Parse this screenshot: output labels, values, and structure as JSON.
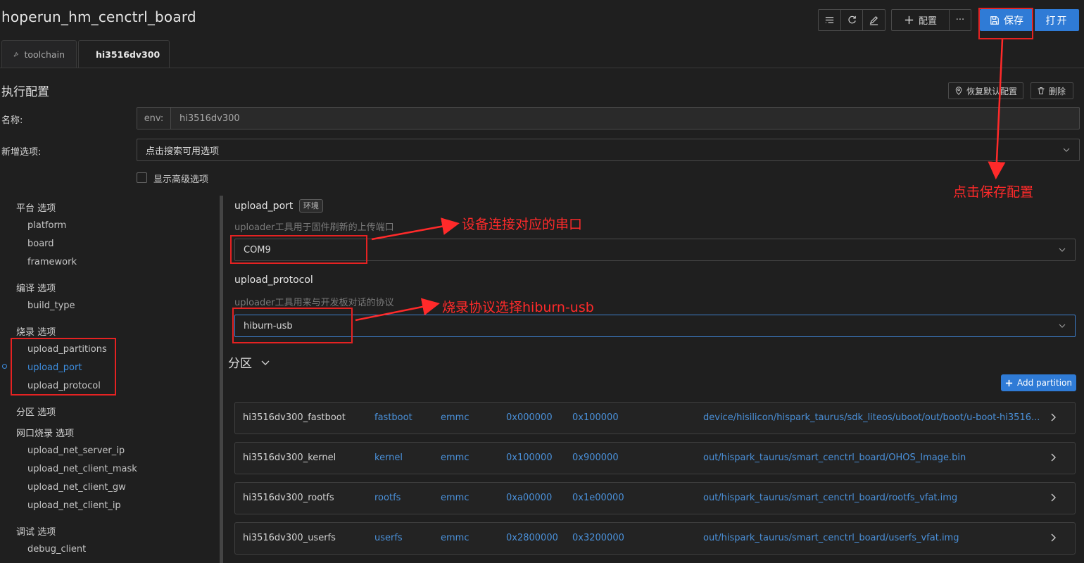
{
  "window": {
    "title": "hoperun_hm_cenctrl_board"
  },
  "toolbar": {
    "list_icon": "list-icon",
    "refresh_icon": "refresh-icon",
    "edit_icon": "edit-icon",
    "add_config_label": "配置",
    "more_label": "···",
    "save_label": "保存",
    "open_label": "打开"
  },
  "tabs": [
    {
      "label": "toolchain",
      "icon": "wrench-icon"
    },
    {
      "label": "hi3516dv300",
      "icon": "location-pin-icon"
    }
  ],
  "section": {
    "title": "执行配置",
    "restore_label": "恢复默认配置",
    "delete_label": "删除"
  },
  "form": {
    "name_label": "名称:",
    "env_prefix": "env:",
    "env_value": "hi3516dv300",
    "add_option_label": "新增选项:",
    "add_option_placeholder": "点击搜索可用选项",
    "show_advanced_label": "显示高级选项"
  },
  "sidebar": {
    "groups": [
      {
        "label": "平台 选项",
        "items": [
          "platform",
          "board",
          "framework"
        ]
      },
      {
        "label": "编译 选项",
        "items": [
          "build_type"
        ]
      },
      {
        "label": "烧录 选项",
        "items": [
          "upload_partitions",
          "upload_port",
          "upload_protocol"
        ]
      },
      {
        "label": "分区 选项",
        "items": []
      },
      {
        "label": "网口烧录 选项",
        "items": [
          "upload_net_server_ip",
          "upload_net_client_mask",
          "upload_net_client_gw",
          "upload_net_client_ip"
        ]
      },
      {
        "label": "调试 选项",
        "items": [
          "debug_client"
        ]
      }
    ],
    "active_item": "upload_port"
  },
  "options": {
    "upload_port": {
      "label": "upload_port",
      "tag": "环境",
      "description": "uploader工具用于固件刷新的上传端口",
      "value": "COM9"
    },
    "upload_protocol": {
      "label": "upload_protocol",
      "description": "uploader工具用来与开发板对话的协议",
      "value": "hiburn-usb"
    }
  },
  "partitions": {
    "title": "分区",
    "add_label": "Add partition",
    "rows": [
      {
        "name": "hi3516dv300_fastboot",
        "type": "fastboot",
        "medium": "emmc",
        "start": "0x000000",
        "length": "0x100000",
        "path": "device/hisilicon/hispark_taurus/sdk_liteos/uboot/out/boot/u-boot-hi3516..."
      },
      {
        "name": "hi3516dv300_kernel",
        "type": "kernel",
        "medium": "emmc",
        "start": "0x100000",
        "length": "0x900000",
        "path": "out/hispark_taurus/smart_cenctrl_board/OHOS_Image.bin"
      },
      {
        "name": "hi3516dv300_rootfs",
        "type": "rootfs",
        "medium": "emmc",
        "start": "0xa00000",
        "length": "0x1e00000",
        "path": "out/hispark_taurus/smart_cenctrl_board/rootfs_vfat.img"
      },
      {
        "name": "hi3516dv300_userfs",
        "type": "userfs",
        "medium": "emmc",
        "start": "0x2800000",
        "length": "0x3200000",
        "path": "out/hispark_taurus/smart_cenctrl_board/userfs_vfat.img"
      }
    ]
  },
  "annotations": {
    "save_note": "点击保存配置",
    "port_note": "设备连接对应的串口",
    "protocol_note": "烧录协议选择hiburn-usb",
    "color": "#ff2a2a"
  },
  "colors": {
    "accent": "#2f7bd6",
    "link": "#4a90d9",
    "background": "#1f1f1f"
  }
}
